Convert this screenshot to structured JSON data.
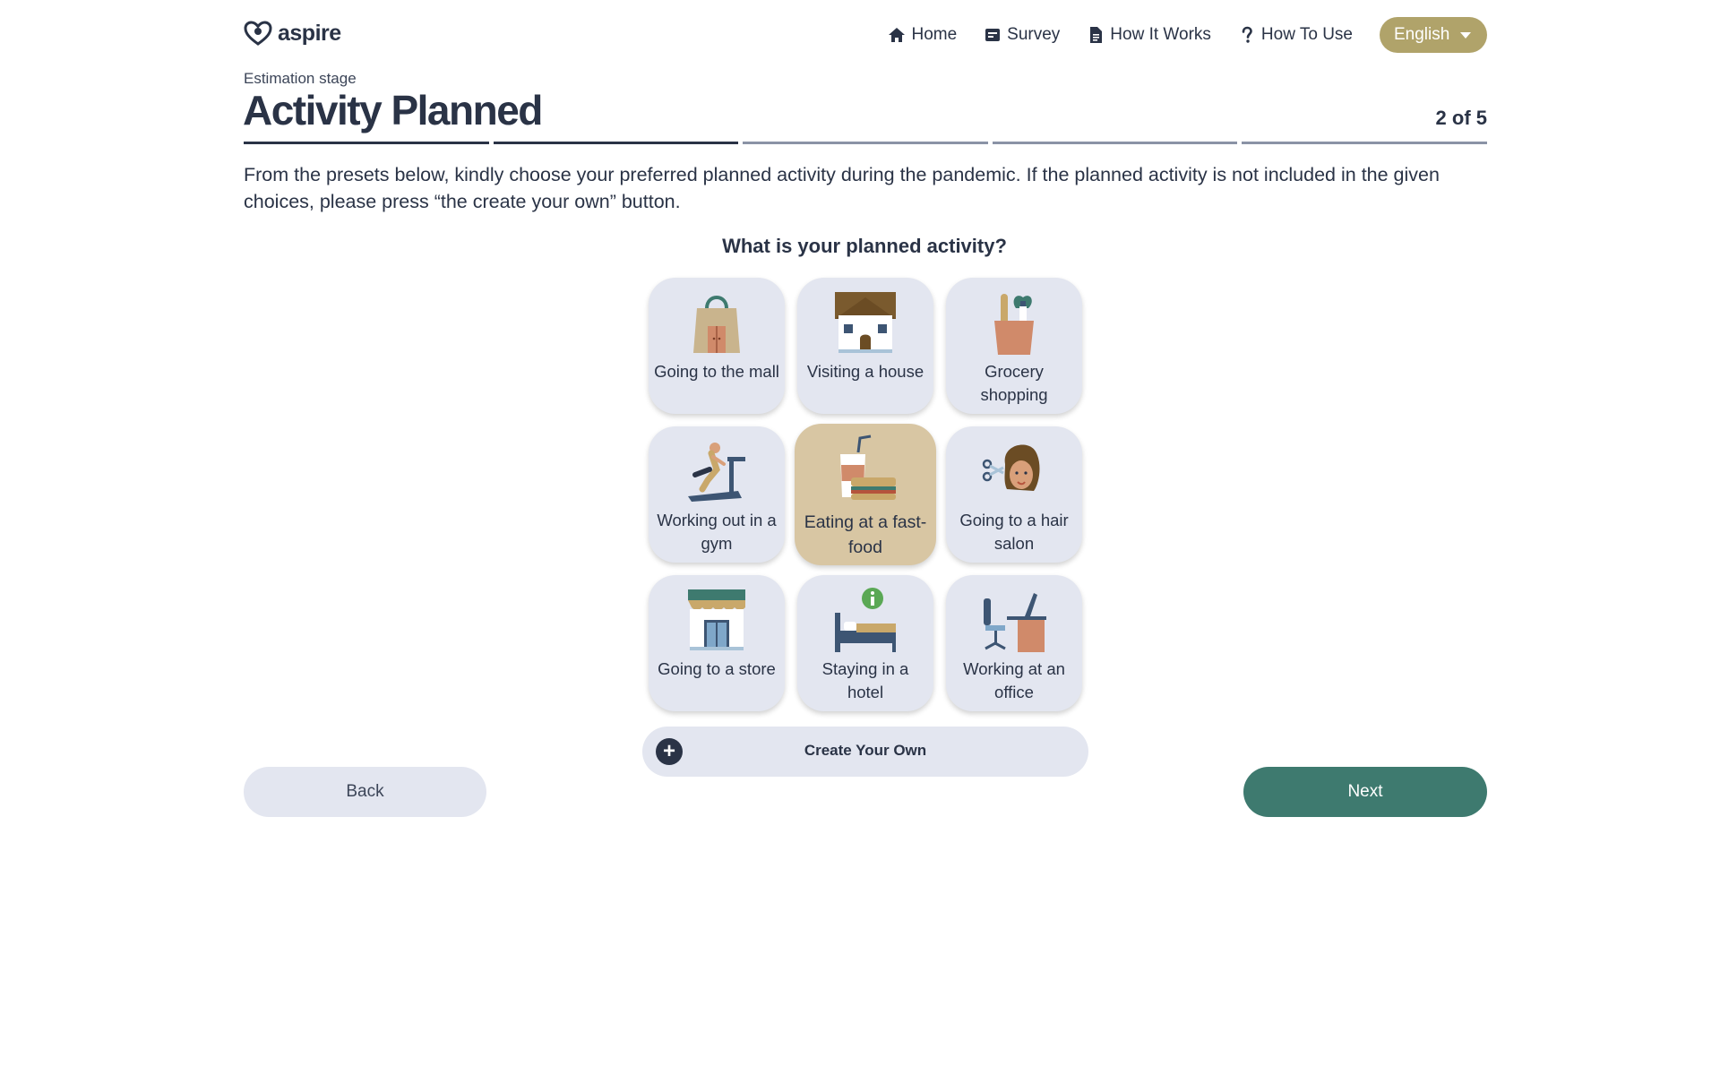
{
  "app": {
    "logo_text": "aspire"
  },
  "nav": {
    "items": [
      {
        "label": "Home",
        "icon": "home-icon"
      },
      {
        "label": "Survey",
        "icon": "survey-icon"
      },
      {
        "label": "How It Works",
        "icon": "document-icon"
      },
      {
        "label": "How To Use",
        "icon": "question-icon"
      }
    ],
    "language": {
      "selected": "English"
    }
  },
  "stage": {
    "label": "Estimation stage",
    "title": "Activity Planned",
    "step": "2 of 5",
    "current_step": 2,
    "total_steps": 5
  },
  "instructions": "From the presets below, kindly choose your preferred planned activity during the pandemic. If the planned activity is not included in the given choices, please press “the create your own” button.",
  "question": "What is your planned activity?",
  "activities": [
    {
      "label": "Going to the mall",
      "icon": "shopping-bag-icon",
      "selected": false
    },
    {
      "label": "Visiting a house",
      "icon": "house-icon",
      "selected": false
    },
    {
      "label": "Grocery shopping",
      "icon": "grocery-bag-icon",
      "selected": false
    },
    {
      "label": "Working out in a gym",
      "icon": "treadmill-icon",
      "selected": false
    },
    {
      "label": "Eating at a fast-food",
      "icon": "fast-food-icon",
      "selected": true
    },
    {
      "label": "Going to a hair salon",
      "icon": "hair-salon-icon",
      "selected": false
    },
    {
      "label": "Going to a store",
      "icon": "storefront-icon",
      "selected": false
    },
    {
      "label": "Staying in a hotel",
      "icon": "hotel-bed-icon",
      "selected": false
    },
    {
      "label": "Working at an office",
      "icon": "office-desk-icon",
      "selected": false
    }
  ],
  "create_own": {
    "label": "Create Your Own",
    "icon": "plus-icon"
  },
  "buttons": {
    "back": "Back",
    "next": "Next"
  },
  "colors": {
    "primary_text": "#2a3346",
    "card_bg": "#e3e6f0",
    "selected_card_bg": "#d8c6a3",
    "language_button": "#b0a36a",
    "next_button": "#3e7a6f"
  }
}
